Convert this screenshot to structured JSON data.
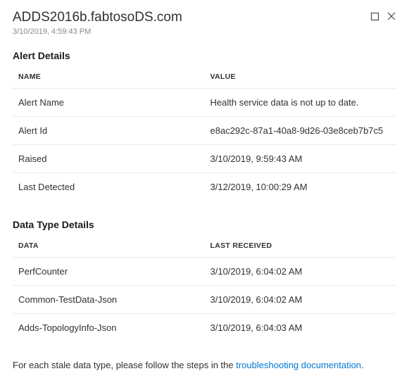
{
  "header": {
    "title": "ADDS2016b.fabtosoDS.com",
    "timestamp": "3/10/2019, 4:59:43 PM"
  },
  "alert_details": {
    "section_title": "Alert Details",
    "columns": {
      "name": "NAME",
      "value": "VALUE"
    },
    "rows": [
      {
        "name": "Alert Name",
        "value": "Health service data is not up to date."
      },
      {
        "name": "Alert Id",
        "value": "e8ac292c-87a1-40a8-9d26-03e8ceb7b7c5"
      },
      {
        "name": "Raised",
        "value": "3/10/2019, 9:59:43 AM"
      },
      {
        "name": "Last Detected",
        "value": "3/12/2019, 10:00:29 AM"
      }
    ]
  },
  "data_type_details": {
    "section_title": "Data Type Details",
    "columns": {
      "data": "DATA",
      "last_received": "LAST RECEIVED"
    },
    "rows": [
      {
        "data": "PerfCounter",
        "last_received": "3/10/2019, 6:04:02 AM"
      },
      {
        "data": "Common-TestData-Json",
        "last_received": "3/10/2019, 6:04:02 AM"
      },
      {
        "data": "Adds-TopologyInfo-Json",
        "last_received": "3/10/2019, 6:04:03 AM"
      }
    ]
  },
  "footer": {
    "prefix": "For each stale data type, please follow the steps in the ",
    "link_text": "troubleshooting documentation",
    "suffix": "."
  }
}
